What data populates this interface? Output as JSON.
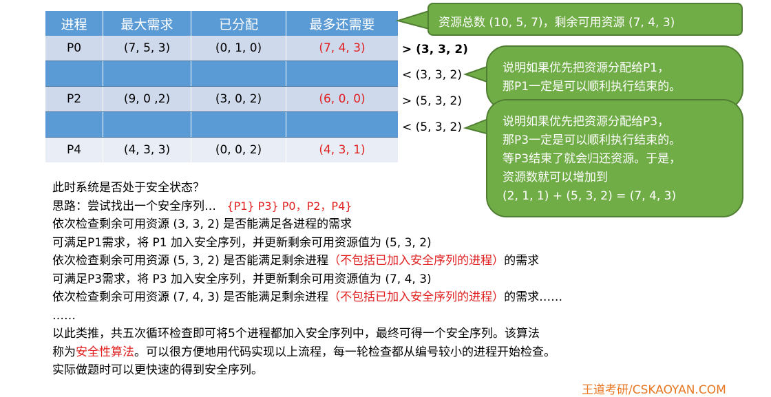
{
  "table": {
    "headers": [
      "进程",
      "最大需求",
      "已分配",
      "最多还需要"
    ],
    "rows": [
      {
        "proc": "P0",
        "max": "(7, 5, 3)",
        "alloc": "(0, 1, 0)",
        "need": "(7, 4, 3)"
      },
      {
        "proc": "",
        "max": "",
        "alloc": "",
        "need": ""
      },
      {
        "proc": "P2",
        "max": "(9, 0 ,2)",
        "alloc": "(3, 0, 2)",
        "need": "(6, 0, 0)"
      },
      {
        "proc": "",
        "max": "",
        "alloc": "",
        "need": ""
      },
      {
        "proc": "P4",
        "max": "(4, 3, 3)",
        "alloc": "(0, 0, 2)",
        "need": "(4, 3, 1)"
      }
    ]
  },
  "comparisons": [
    "> (3, 3, 2)",
    "< (3, 3, 2)",
    "> (5, 3, 2)",
    "< (5, 3, 2)"
  ],
  "bubbles": {
    "total": "资源总数 (10, 5, 7)，剩余可用资源 (7, 4, 3)",
    "p1": [
      "说明如果优先把资源分配给P1，",
      "那P1一定是可以顺利执行结束的。"
    ],
    "p3": [
      "说明如果优先把资源分配给P3，",
      "那P3一定是可以顺利执行结束的。",
      "等P3结束了就会归还资源。于是，",
      "资源数就可以增加到",
      "(2, 1, 1) + (5, 3, 2) = (7, 4, 3)"
    ]
  },
  "text": {
    "q": "此时系统是否处于安全状态？",
    "idea_prefix": "思路：尝试找出一个安全序列…",
    "idea_seq": "{P1}  P3}  P0，P2，P4}",
    "l1": "依次检查剩余可用资源 (3, 3, 2) 是否能满足各进程的需求",
    "l2": "可满足P1需求，将 P1 加入安全序列，并更新剩余可用资源值为 (5, 3, 2)",
    "l3a": "依次检查剩余可用资源 (5, 3, 2) 是否能满足剩余进程",
    "l3b": "（不包括已加入安全序列的进程）",
    "l3c": "的需求",
    "l4": "可满足P3需求，将 P3 加入安全序列，并更新剩余可用资源值为 (7, 4, 3)",
    "l5a": "依次检查剩余可用资源 (7, 4, 3) 是否能满足剩余进程",
    "l5b": "（不包括已加入安全序列的进程）",
    "l5c": "的需求……",
    "l6": "……",
    "l7": "以此类推，共五次循环检查即可将5个进程都加入安全序列中，最终可得一个安全序列。该算法",
    "l8a": "称为",
    "l8b": "安全性算法",
    "l8c": "。可以很方便地用代码实现以上流程，每一轮检查都从编号较小的进程开始检查。",
    "l9": "实际做题时可以更快速的得到安全序列。"
  },
  "footer": "王道考研/CSKAOYAN.COM",
  "colors": {
    "header_blue": "#5b9bd5",
    "bubble_green": "#70ad47",
    "emphasis_red": "#e02020"
  }
}
